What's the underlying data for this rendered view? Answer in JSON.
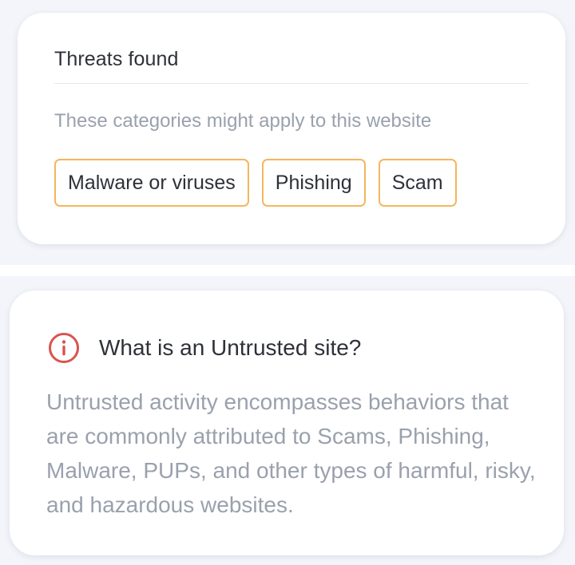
{
  "threats_card": {
    "title": "Threats found",
    "subtitle": "These categories might apply to this website",
    "categories": [
      {
        "label": "Malware or viruses"
      },
      {
        "label": "Phishing"
      },
      {
        "label": "Scam"
      }
    ],
    "chip_border_color": "#f4b65c"
  },
  "info_card": {
    "icon": "info-circle-icon",
    "icon_color": "#d9534f",
    "title": "What is an Untrusted site?",
    "body": "Untrusted activity encompasses behaviors that are commonly attributed to Scams, Phishing, Malware, PUPs, and other types of harmful, risky, and hazardous websites."
  }
}
